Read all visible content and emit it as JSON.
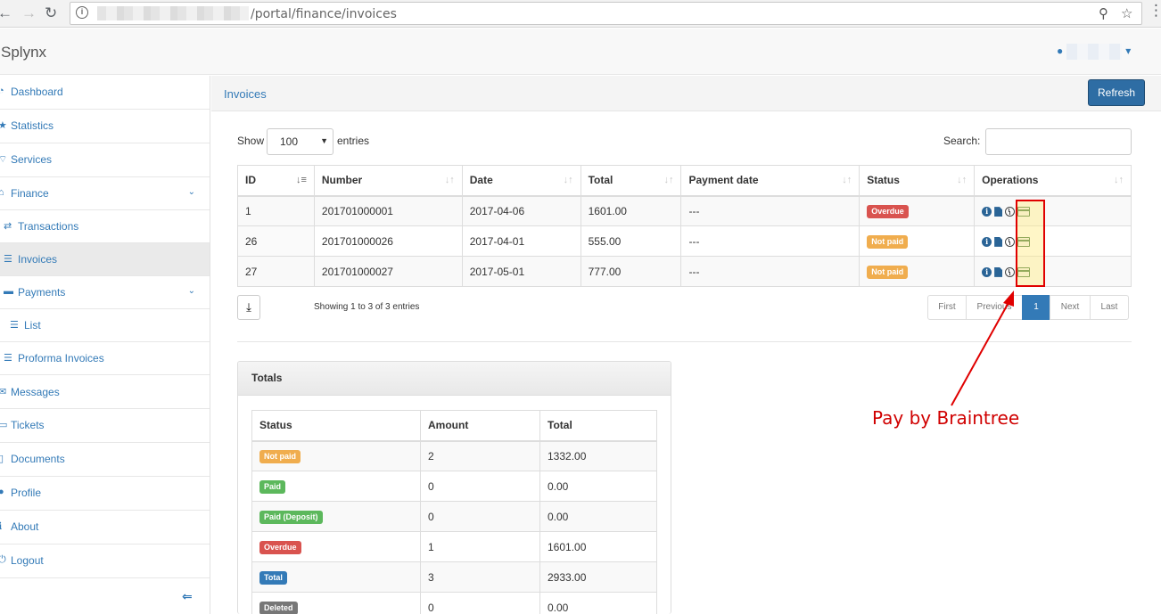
{
  "browser": {
    "url_path": "/portal/finance/invoices"
  },
  "app": {
    "brand": "Splynx",
    "user_caret": "▾"
  },
  "sidebar": {
    "items": [
      {
        "label": "Dashboard",
        "icon": "dashboard-icon"
      },
      {
        "label": "Statistics",
        "icon": "star-icon"
      },
      {
        "label": "Services",
        "icon": "wifi-icon"
      },
      {
        "label": "Finance",
        "icon": "bank-icon",
        "expanded": true
      },
      {
        "label": "Transactions",
        "icon": "exchange-icon",
        "sub": true
      },
      {
        "label": "Invoices",
        "icon": "list-icon",
        "sub": true,
        "active": true
      },
      {
        "label": "Payments",
        "icon": "credit-card-icon",
        "sub": true,
        "expanded": true
      },
      {
        "label": "List",
        "icon": "list-icon",
        "subsub": true
      },
      {
        "label": "Proforma Invoices",
        "icon": "list-icon",
        "sub": true
      },
      {
        "label": "Messages",
        "icon": "envelope-icon"
      },
      {
        "label": "Tickets",
        "icon": "ticket-icon"
      },
      {
        "label": "Documents",
        "icon": "file-icon"
      },
      {
        "label": "Profile",
        "icon": "user-icon"
      },
      {
        "label": "About",
        "icon": "info-icon"
      },
      {
        "label": "Logout",
        "icon": "logout-icon"
      }
    ]
  },
  "page": {
    "title": "Invoices",
    "refresh_label": "Refresh"
  },
  "table_controls": {
    "show_label": "Show",
    "page_size": "100",
    "entries_label": "entries",
    "search_label": "Search:",
    "search_value": ""
  },
  "invoices": {
    "columns": [
      "ID",
      "Number",
      "Date",
      "Total",
      "Payment date",
      "Status",
      "Operations"
    ],
    "rows": [
      {
        "id": "1",
        "number": "201701000001",
        "date": "2017-04-06",
        "total": "1601.00",
        "payment_date": "---",
        "status": "Overdue",
        "status_color": "#d9534f"
      },
      {
        "id": "26",
        "number": "201701000026",
        "date": "2017-04-01",
        "total": "555.00",
        "payment_date": "---",
        "status": "Not paid",
        "status_color": "#f0ad4e"
      },
      {
        "id": "27",
        "number": "201701000027",
        "date": "2017-05-01",
        "total": "777.00",
        "payment_date": "---",
        "status": "Not paid",
        "status_color": "#f0ad4e"
      }
    ],
    "showing_info": "Showing 1 to 3 of 3 entries"
  },
  "pagination": {
    "first": "First",
    "previous": "Previous",
    "current": "1",
    "next": "Next",
    "last": "Last"
  },
  "totals": {
    "title": "Totals",
    "columns": [
      "Status",
      "Amount",
      "Total"
    ],
    "rows": [
      {
        "status": "Not paid",
        "color": "#f0ad4e",
        "amount": "2",
        "total": "1332.00"
      },
      {
        "status": "Paid",
        "color": "#5cb85c",
        "amount": "0",
        "total": "0.00"
      },
      {
        "status": "Paid (Deposit)",
        "color": "#5cb85c",
        "amount": "0",
        "total": "0.00"
      },
      {
        "status": "Overdue",
        "color": "#d9534f",
        "amount": "1",
        "total": "1601.00"
      },
      {
        "status": "Total",
        "color": "#337ab7",
        "amount": "3",
        "total": "2933.00"
      },
      {
        "status": "Deleted",
        "color": "#777777",
        "amount": "0",
        "total": "0.00"
      }
    ]
  },
  "annotation": {
    "text": "Pay by Braintree",
    "color": "#d00000"
  }
}
